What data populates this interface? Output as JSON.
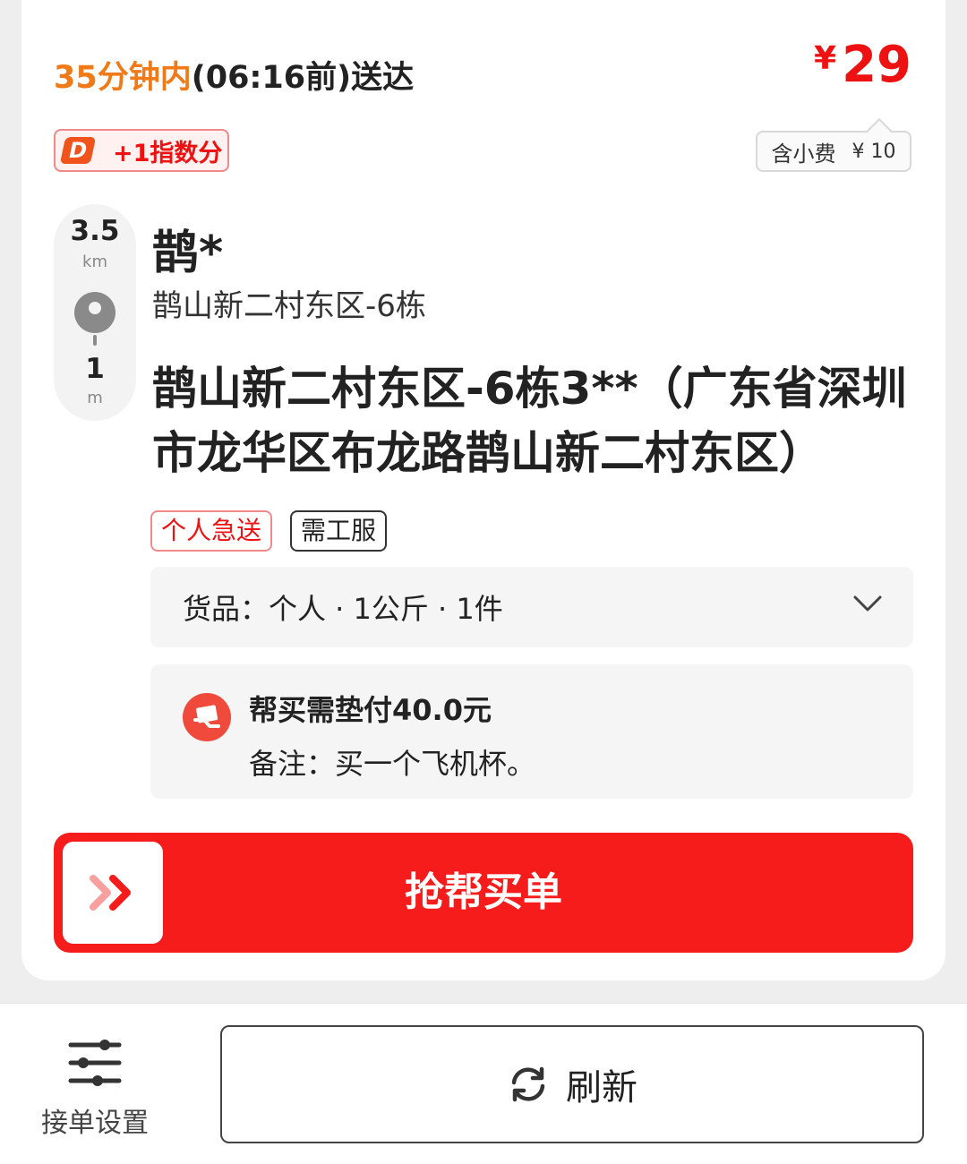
{
  "order": {
    "eta_highlight": "35分钟内",
    "eta_rest": "(06:16前)送达",
    "price_currency": "¥",
    "price_amount": "29",
    "points_label": "+1指数分",
    "tip_label": "含小费",
    "tip_amount": "¥ 10",
    "distance_1": "3.5",
    "distance_1_unit": "km",
    "distance_2": "1",
    "distance_2_unit": "m",
    "store_name": "鹊*",
    "store_address": "鹊山新二村东区-6栋",
    "delivery_address": "鹊山新二村东区-6栋3**（广东省深圳市龙华区布龙路鹊山新二村东区）",
    "tags": [
      "个人急送",
      "需工服"
    ],
    "goods": "货品：个人 · 1公斤 · 1件",
    "buy_advance": "帮买需垫付40.0元",
    "remark": "备注：买一个飞机杯。",
    "grab_button": "抢帮买单"
  },
  "bottombar": {
    "settings_label": "接单设置",
    "refresh_label": "刷新"
  },
  "colors": {
    "accent_red": "#f61c1c",
    "eta_orange": "#f07a18",
    "price_red": "#ee1111"
  },
  "icons": [
    "points-badge-icon",
    "location-pin-icon",
    "chevron-down-icon",
    "buy-money-icon",
    "double-chevron-right-icon",
    "sliders-icon",
    "refresh-icon"
  ]
}
